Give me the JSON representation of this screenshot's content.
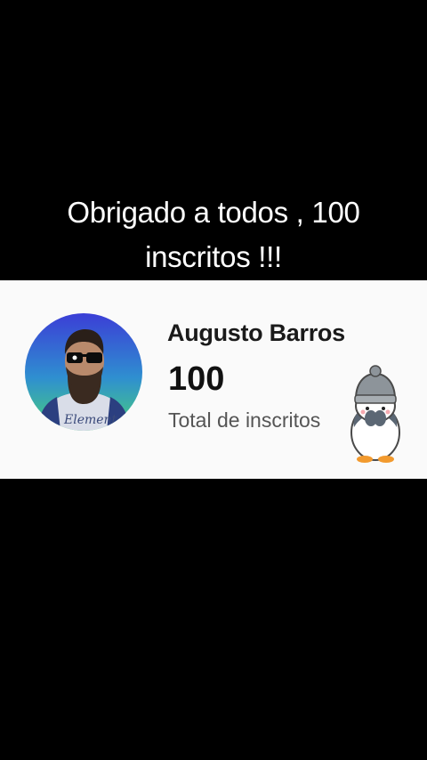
{
  "caption": {
    "line1": "Obrigado a todos , 100",
    "line2": "inscritos !!!"
  },
  "card": {
    "channel_name": "Augusto Barros",
    "subscriber_count": "100",
    "subscriber_label": "Total de inscritos",
    "shirt_text": "Element",
    "icons": [
      "avatar-photo",
      "penguin-sticker-icon"
    ]
  },
  "colors": {
    "background": "#000000",
    "card_background": "#fafafa",
    "avatar_gradient_top": "#3b3ed6",
    "avatar_gradient_bottom": "#49d07a"
  }
}
